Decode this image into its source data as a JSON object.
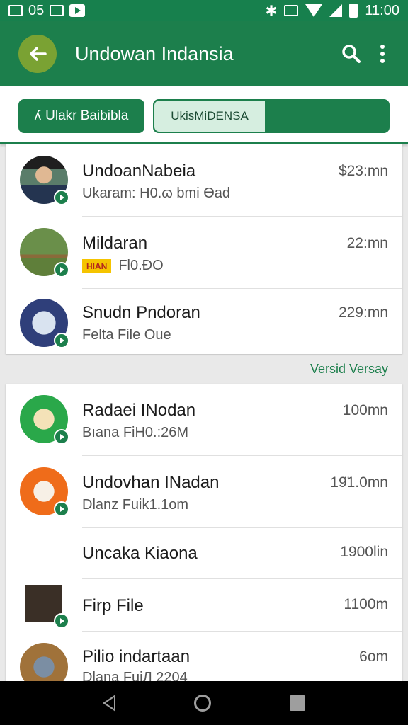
{
  "status_bar": {
    "left_text": "05",
    "time": "11:00"
  },
  "app_bar": {
    "title": "Undowan Indansia"
  },
  "tabs": {
    "primary_label": "Ulakr Baibibla",
    "secondary_label": "UkisMiDENSA"
  },
  "list_top": [
    {
      "title": "UndoanNabeia",
      "subtitle": "Ukaram: H0.ɷ bmi Ɵad",
      "time": "$23:mn"
    },
    {
      "title": "Mildaran",
      "subtitle": "Fl0.ƉO",
      "tag": "HIAN",
      "time": "22:mn"
    },
    {
      "title": "Snudn Pndoran",
      "subtitle": "Felta File Ouе",
      "time": "229:mn"
    }
  ],
  "section_label": "Versid Versay",
  "list_bottom": [
    {
      "title": "Radaei INodan",
      "subtitle": "Bıana FiH0.:26M",
      "time": "100mn"
    },
    {
      "title": "Undovhan INadan",
      "subtitle": "Dlanz Fuik1.1om",
      "time": "19̈1.0mn"
    },
    {
      "title": "Uncaka Kiaona",
      "subtitle": "",
      "time": "1900lin"
    },
    {
      "title": "Firp Filе",
      "subtitle": "",
      "time": "1100m"
    },
    {
      "title": "Pilio indartaan",
      "subtitle": "Dlana FuiЛ 2204",
      "time": "6om"
    }
  ],
  "colors": {
    "primary": "#1c7f4c",
    "accent": "#7aa233"
  }
}
